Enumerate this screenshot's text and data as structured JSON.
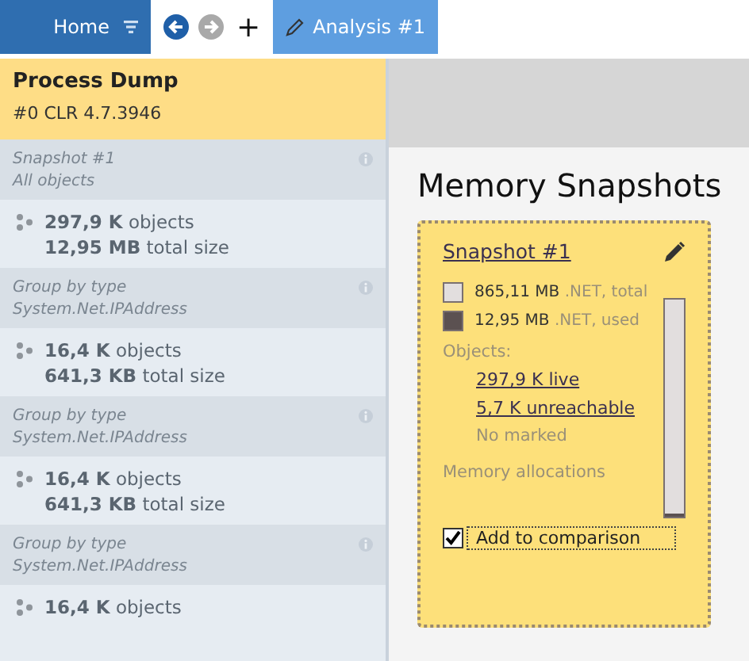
{
  "toolbar": {
    "home_label": "Home",
    "nav": [
      {
        "kind": "back",
        "disabled": false
      },
      {
        "kind": "forward",
        "disabled": true
      }
    ],
    "add_label": "+"
  },
  "tabs": [
    {
      "label": "Analysis #1",
      "selected": true
    }
  ],
  "process": {
    "title": "Process Dump",
    "subtitle": "#0 CLR 4.7.3946"
  },
  "steps": [
    {
      "title": "Snapshot #1",
      "subtitle": "All objects",
      "count_value": "297,9 K",
      "count_unit": "objects",
      "size_value": "12,95 MB",
      "size_unit": "total size"
    },
    {
      "title": "Group by type",
      "subtitle": "System.Net.IPAddress",
      "count_value": "16,4 K",
      "count_unit": "objects",
      "size_value": "641,3 KB",
      "size_unit": "total size"
    },
    {
      "title": "Group by type",
      "subtitle": "System.Net.IPAddress",
      "count_value": "16,4 K",
      "count_unit": "objects",
      "size_value": "641,3 KB",
      "size_unit": "total size"
    },
    {
      "title": "Group by type",
      "subtitle": "System.Net.IPAddress",
      "count_value": "16,4 K",
      "count_unit": "objects"
    }
  ],
  "main": {
    "title": "Memory Snapshots",
    "snapshot": {
      "title": "Snapshot #1",
      "legend": [
        {
          "value": "865,11 MB",
          "label": ".NET, total",
          "color": "#e2dede"
        },
        {
          "value": "12,95 MB",
          "label": ".NET, used",
          "color": "#5b5151"
        }
      ],
      "level": 0.015,
      "objects_label": "Objects:",
      "links": [
        "297,9 K live",
        "5,7 K unreachable"
      ],
      "no_marked": "No marked",
      "allocations_label": "Memory allocations",
      "comparison": {
        "label": "Add to comparison",
        "checked": true
      }
    }
  }
}
